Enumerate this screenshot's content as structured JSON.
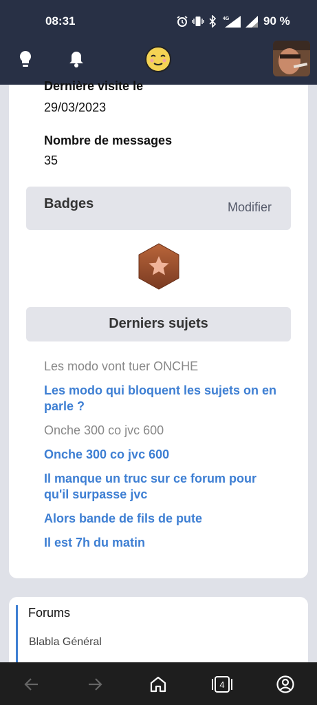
{
  "status_bar": {
    "time": "08:31",
    "network": "4G",
    "battery": "90 %"
  },
  "header": {
    "icons": [
      "lightbulb-icon",
      "bell-icon",
      "smiley-logo-icon"
    ]
  },
  "profile": {
    "last_visit_label": "Dernière visite le",
    "last_visit_value": "29/03/2023",
    "messages_label": "Nombre de messages",
    "messages_value": "35"
  },
  "badges": {
    "title": "Badges",
    "edit_label": "Modifier",
    "items": [
      "star-badge"
    ]
  },
  "recent_topics": {
    "title": "Derniers sujets",
    "items": [
      {
        "label": "Les modo vont tuer ONCHE",
        "visited": true
      },
      {
        "label": "Les modo qui bloquent les sujets on en parle ?",
        "visited": false
      },
      {
        "label": "Onche 300 co jvc 600",
        "visited": true
      },
      {
        "label": "Onche 300 co jvc 600",
        "visited": false
      },
      {
        "label": "Il manque un truc sur ce forum pour qu'il surpasse jvc",
        "visited": false
      },
      {
        "label": "Alors bande de fils de pute",
        "visited": false
      },
      {
        "label": "Il est 7h du matin",
        "visited": false
      }
    ]
  },
  "forums": {
    "title": "Forums",
    "items": [
      "Blabla Général"
    ]
  },
  "bottom_nav": {
    "tabs_count": "4"
  },
  "colors": {
    "header_bg": "#283045",
    "link": "#3e7fd3",
    "badge": "#a0522d"
  }
}
